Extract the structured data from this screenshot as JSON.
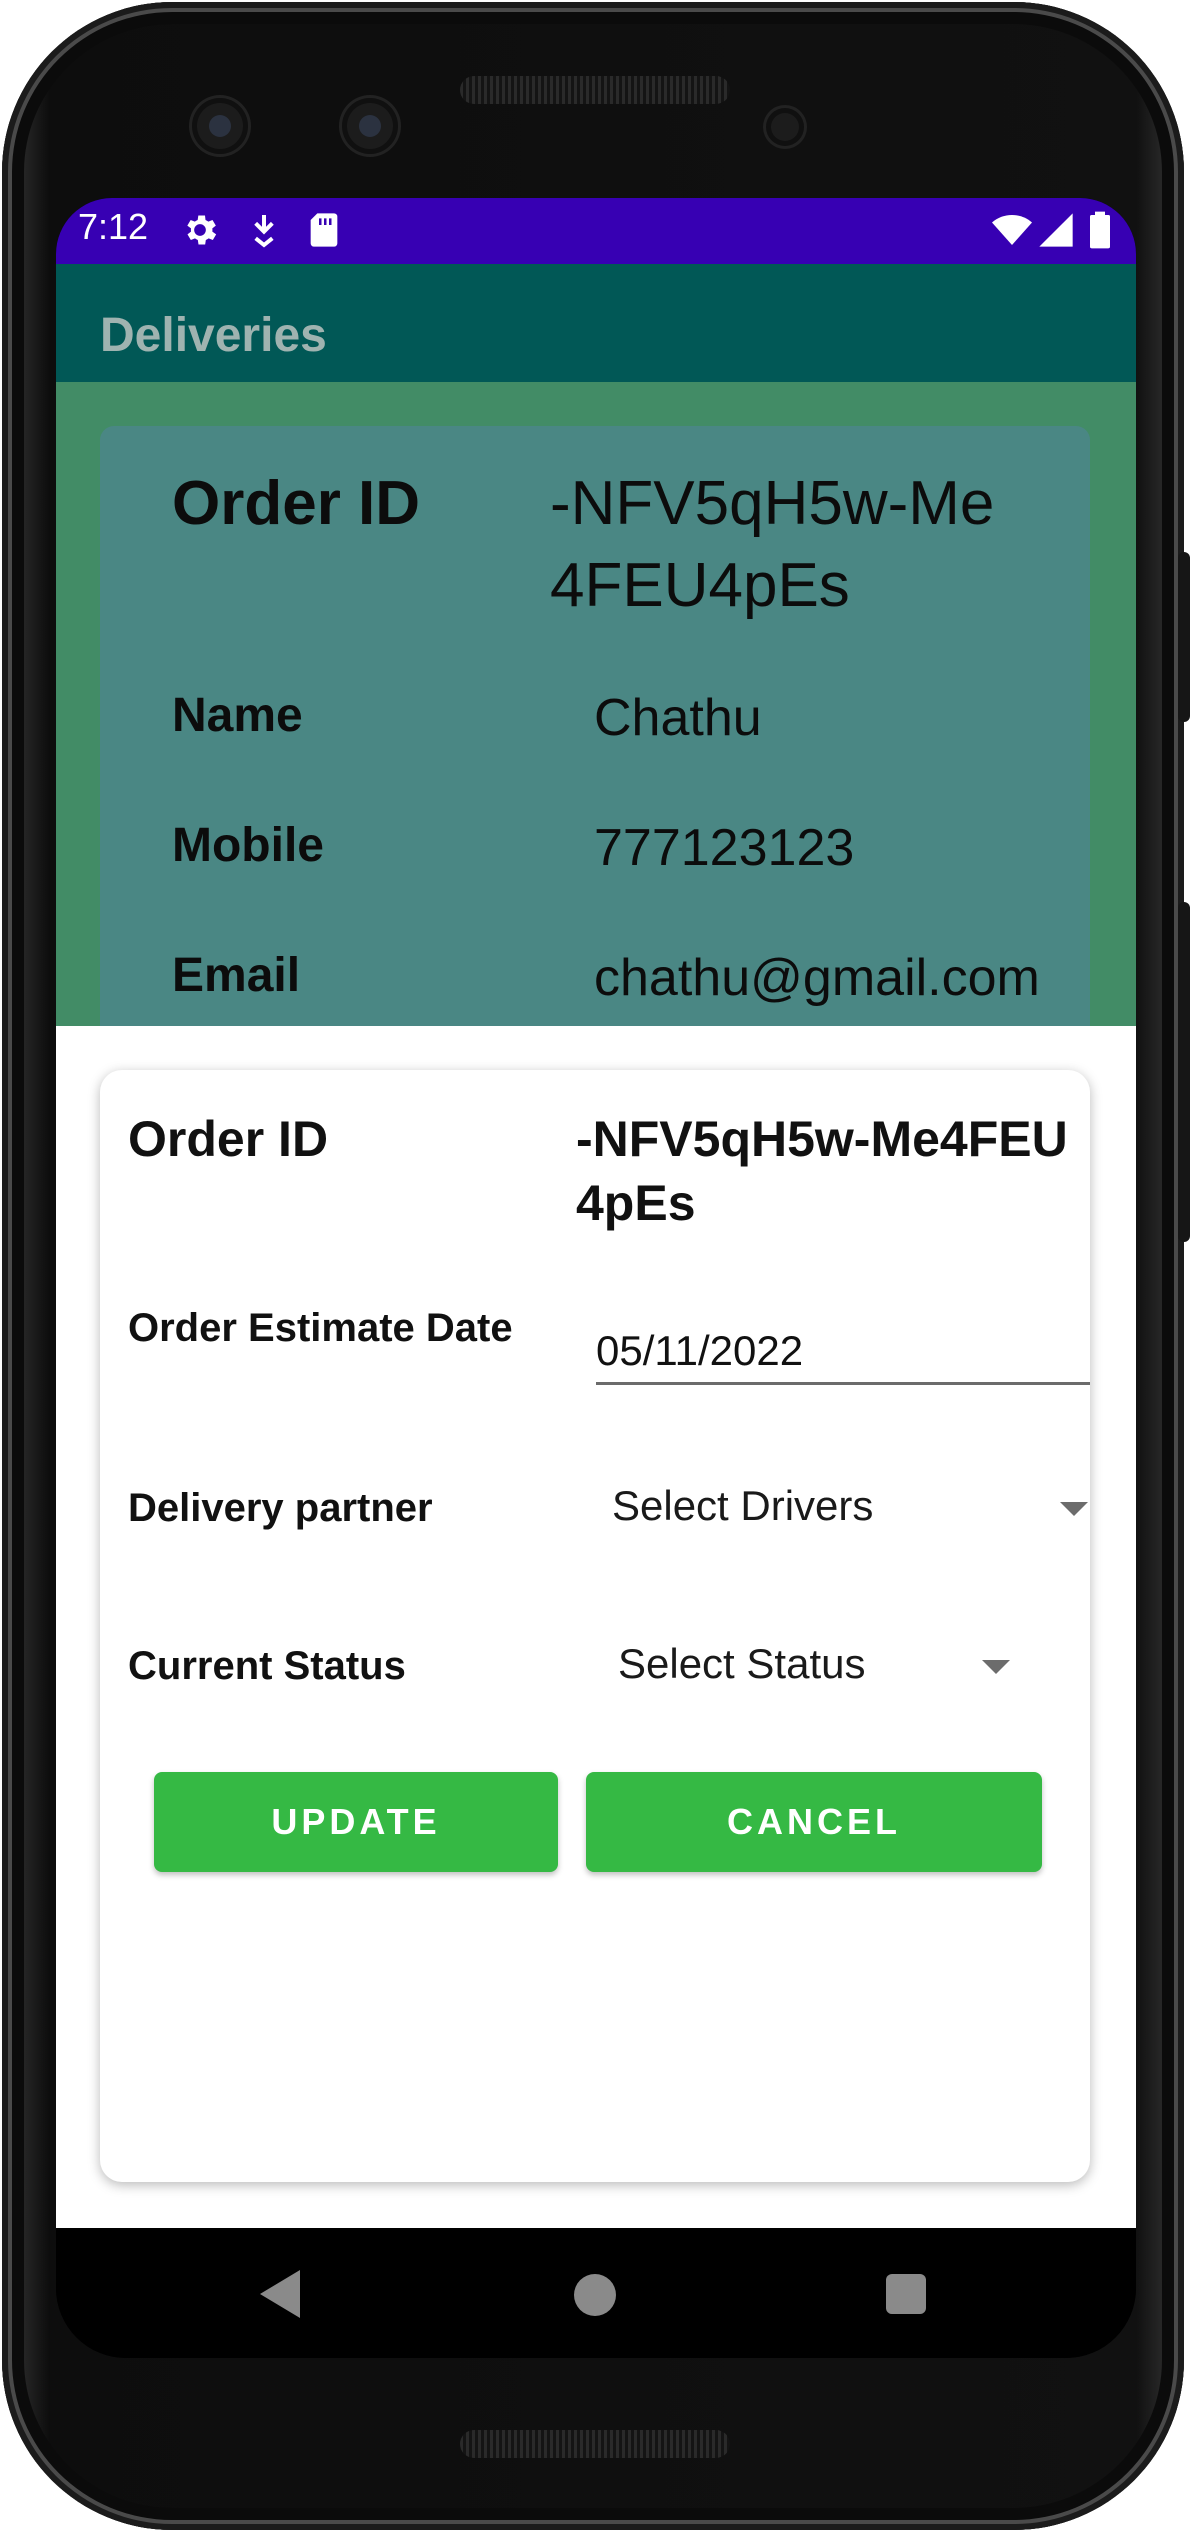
{
  "status_bar": {
    "time": "7:12",
    "left_icons": [
      "gear-icon",
      "download-icon",
      "sd-card-icon"
    ],
    "right_icons": [
      "wifi-icon",
      "cell-signal-icon",
      "battery-icon"
    ],
    "color": "#3700b3"
  },
  "toolbar": {
    "title": "Deliveries",
    "color": "#015856"
  },
  "background_card": {
    "order_id_label": "Order ID",
    "order_id_value_line1": "-NFV5qH5w-Me",
    "order_id_value_line2": "4FEU4pEs",
    "name_label": "Name",
    "name_value": "Chathu",
    "mobile_label": "Mobile",
    "mobile_value": "777123123",
    "email_label": "Email",
    "email_value": "chathu@gmail.com"
  },
  "dialog": {
    "order_id_label": "Order ID",
    "order_id_value_line1": "-NFV5qH5w-Me4FEU",
    "order_id_value_line2": "4pEs",
    "estimate_date_label": "Order Estimate Date",
    "estimate_date_value": "05/11/2022",
    "delivery_partner_label": "Delivery partner",
    "delivery_partner_selected": "Select Drivers",
    "current_status_label": "Current Status",
    "current_status_selected": "Select Status",
    "update_label": "UPDATE",
    "cancel_label": "CANCEL",
    "button_color": "#35b944"
  },
  "nav_bar": {
    "icons": [
      "back-icon",
      "home-icon",
      "recents-icon"
    ]
  }
}
